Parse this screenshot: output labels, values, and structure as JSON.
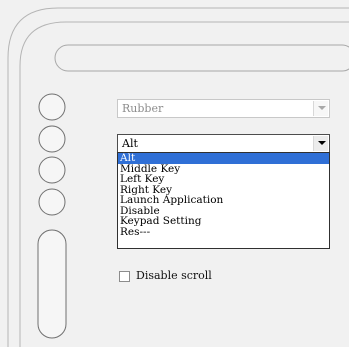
{
  "function_combo": {
    "value": "Rubber",
    "disabled": true
  },
  "key_combo": {
    "value": "Alt",
    "options": [
      "Alt",
      "Middle Key",
      "Left Key",
      "Right Key",
      "Launch Application",
      "Disable",
      "Keypad Setting",
      "Res---"
    ],
    "selected_index": 0
  },
  "disable_scroll": {
    "label": "Disable scroll",
    "checked": false
  },
  "colors": {
    "selection": "#2f6fd6",
    "background": "#f1f1f1"
  }
}
